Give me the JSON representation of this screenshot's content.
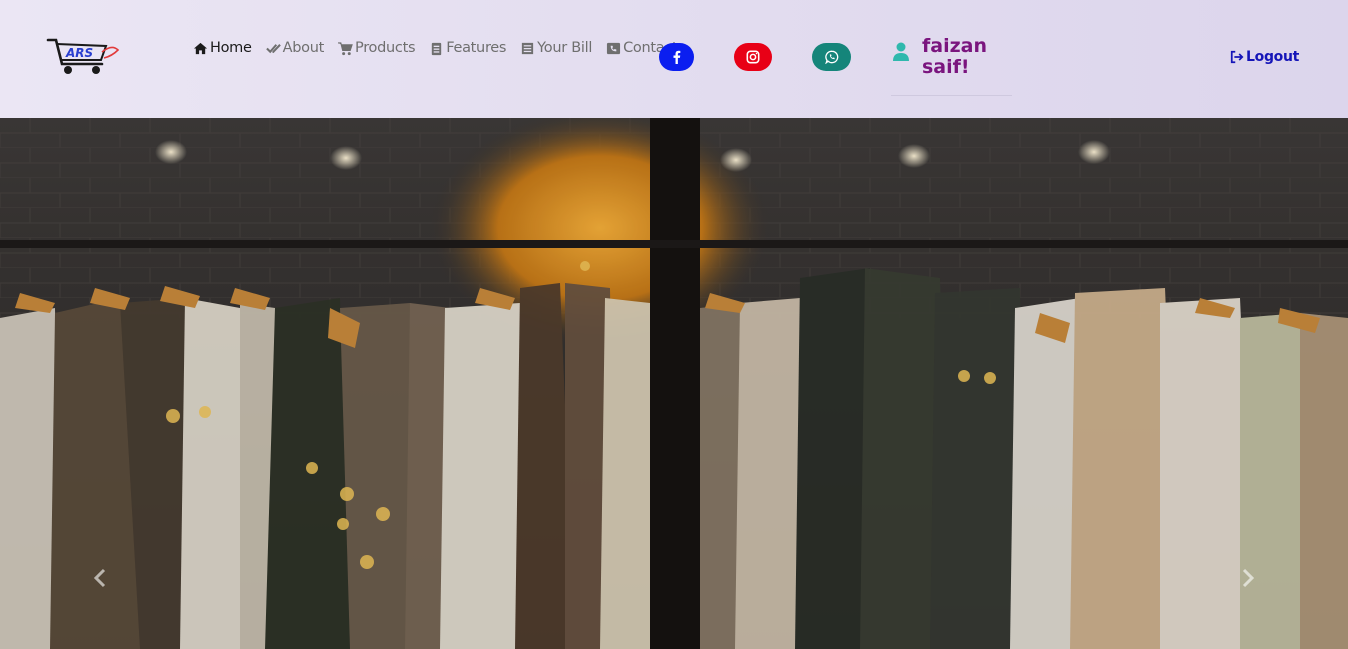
{
  "header": {
    "logo_text": "ARS",
    "nav": [
      {
        "label": "Home",
        "icon": "home-icon",
        "active": true
      },
      {
        "label": "About",
        "icon": "double-check-icon",
        "active": false
      },
      {
        "label": "Products",
        "icon": "cart-icon",
        "active": false
      },
      {
        "label": "Features",
        "icon": "clipboard-icon",
        "active": false
      },
      {
        "label": "Your Bill",
        "icon": "receipt-icon",
        "active": false
      },
      {
        "label": "Contact",
        "icon": "phone-icon",
        "active": false
      }
    ],
    "social": [
      {
        "name": "facebook",
        "icon": "facebook-icon",
        "color": "#0b1ef0"
      },
      {
        "name": "instagram",
        "icon": "instagram-icon",
        "color": "#e80016"
      },
      {
        "name": "whatsapp",
        "icon": "whatsapp-icon",
        "color": "#15857a"
      }
    ],
    "user": {
      "name": "faizan saif!",
      "icon": "user-icon",
      "name_color": "#7a157e",
      "icon_color": "#2fb8ad"
    },
    "logout_label": "Logout"
  },
  "carousel": {
    "prev_icon": "chevron-left-icon",
    "next_icon": "chevron-right-icon",
    "image": "clothing-rack-photo"
  }
}
